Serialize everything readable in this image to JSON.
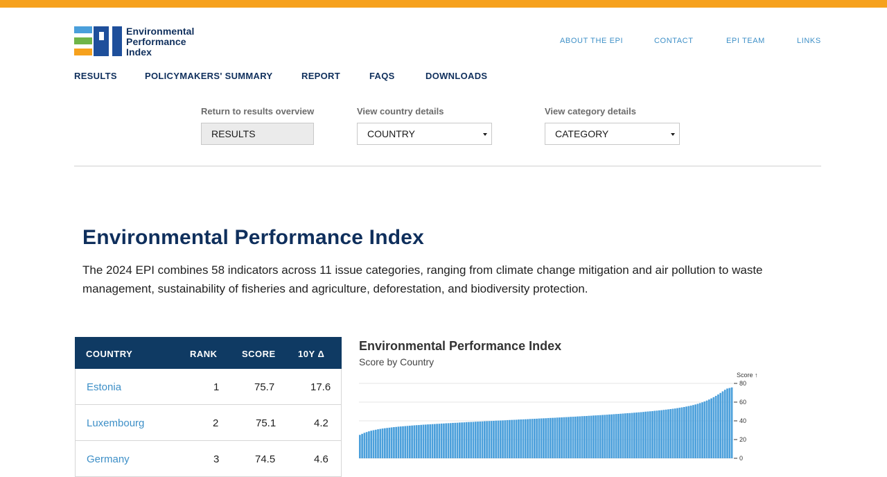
{
  "logo": {
    "line1": "Environmental",
    "line2": "Performance",
    "line3": "Index"
  },
  "util_nav": [
    "ABOUT THE EPI",
    "CONTACT",
    "EPI TEAM",
    "LINKS"
  ],
  "main_nav": [
    "RESULTS",
    "POLICYMAKERS' SUMMARY",
    "REPORT",
    "FAQS",
    "DOWNLOADS"
  ],
  "filters": {
    "results": {
      "label": "Return to results overview",
      "button": "RESULTS"
    },
    "country": {
      "label": "View country details",
      "value": "COUNTRY"
    },
    "category": {
      "label": "View category details",
      "value": "CATEGORY"
    }
  },
  "page": {
    "title": "Environmental Performance Index",
    "intro": "The 2024 EPI combines 58 indicators across 11 issue categories, ranging from climate change mitigation and air pollution to waste management, sustainability of fisheries and agriculture, deforestation, and biodiversity protection."
  },
  "table": {
    "headers": [
      "COUNTRY",
      "RANK",
      "SCORE",
      "10Y Δ"
    ],
    "rows": [
      {
        "country": "Estonia",
        "rank": "1",
        "score": "75.7",
        "change": "17.6"
      },
      {
        "country": "Luxembourg",
        "rank": "2",
        "score": "75.1",
        "change": "4.2"
      },
      {
        "country": "Germany",
        "rank": "3",
        "score": "74.5",
        "change": "4.6"
      }
    ]
  },
  "chart_data": {
    "type": "bar",
    "title": "Environmental Performance Index",
    "subtitle": "Score by Country",
    "ylabel": "Score ↑",
    "ylim": [
      0,
      80
    ],
    "yticks": [
      0,
      20,
      40,
      60,
      80
    ],
    "bar_color": "#4a9fdb",
    "categories": [],
    "values": [
      25.0,
      26.1,
      27.2,
      28.0,
      28.8,
      29.5,
      30.0,
      30.5,
      31.0,
      31.4,
      31.8,
      32.1,
      32.4,
      32.7,
      33.0,
      33.3,
      33.5,
      33.8,
      34.0,
      34.2,
      34.4,
      34.6,
      34.8,
      35.0,
      35.2,
      35.4,
      35.5,
      35.7,
      35.9,
      36.0,
      36.2,
      36.3,
      36.5,
      36.6,
      36.8,
      36.9,
      37.1,
      37.2,
      37.4,
      37.5,
      37.6,
      37.8,
      37.9,
      38.0,
      38.2,
      38.3,
      38.4,
      38.6,
      38.7,
      38.8,
      38.9,
      39.1,
      39.2,
      39.3,
      39.4,
      39.6,
      39.7,
      39.8,
      39.9,
      40.0,
      40.2,
      40.3,
      40.4,
      40.5,
      40.6,
      40.8,
      40.9,
      41.0,
      41.1,
      41.2,
      41.4,
      41.5,
      41.6,
      41.7,
      41.8,
      42.0,
      42.1,
      42.2,
      42.3,
      42.5,
      42.6,
      42.7,
      42.8,
      43.0,
      43.1,
      43.2,
      43.3,
      43.5,
      43.6,
      43.7,
      43.9,
      44.0,
      44.1,
      44.3,
      44.4,
      44.5,
      44.7,
      44.8,
      45.0,
      45.1,
      45.2,
      45.4,
      45.5,
      45.7,
      45.8,
      46.0,
      46.1,
      46.3,
      46.4,
      46.6,
      46.8,
      46.9,
      47.1,
      47.3,
      47.4,
      47.6,
      47.8,
      48.0,
      48.2,
      48.3,
      48.5,
      48.7,
      48.9,
      49.1,
      49.3,
      49.5,
      49.8,
      50.0,
      50.2,
      50.4,
      50.7,
      50.9,
      51.2,
      51.4,
      51.7,
      52.0,
      52.3,
      52.6,
      52.9,
      53.2,
      53.6,
      54.0,
      54.4,
      54.8,
      55.3,
      55.8,
      56.3,
      56.9,
      57.5,
      58.2,
      59.0,
      59.8,
      60.7,
      61.7,
      62.8,
      64.0,
      65.3,
      66.7,
      68.2,
      69.8,
      71.5,
      73.2,
      74.5,
      75.1,
      75.7
    ]
  }
}
